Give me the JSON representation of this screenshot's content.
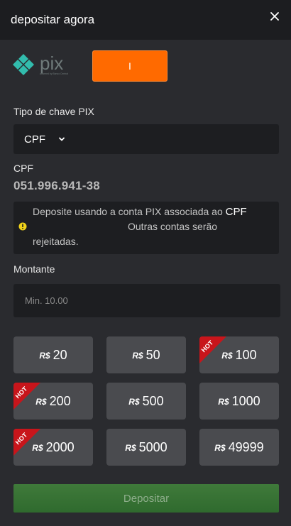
{
  "header": {
    "title": "depositar agora"
  },
  "payment": {
    "logo_text": "pix",
    "logo_subtext": "powered by Banco Central",
    "tab_label": "I"
  },
  "key_type": {
    "label": "Tipo de chave PIX",
    "selected": "CPF"
  },
  "cpf": {
    "label": "CPF",
    "value": "051.996.941-38"
  },
  "notice": {
    "text_before": "Deposite usando a conta PIX associada ao ",
    "highlight": "CPF",
    "text_after_line2": "Outras contas serão",
    "text_line3": "rejeitadas."
  },
  "amount": {
    "label": "Montante",
    "placeholder": "Min. 10.00"
  },
  "presets": {
    "currency": "R$",
    "hot_label": "HOT",
    "items": [
      {
        "value": "20",
        "hot": false
      },
      {
        "value": "50",
        "hot": false
      },
      {
        "value": "100",
        "hot": true
      },
      {
        "value": "200",
        "hot": true
      },
      {
        "value": "500",
        "hot": false
      },
      {
        "value": "1000",
        "hot": false
      },
      {
        "value": "2000",
        "hot": true
      },
      {
        "value": "5000",
        "hot": false
      },
      {
        "value": "49999",
        "hot": false
      }
    ]
  },
  "submit": {
    "label": "Depositar"
  },
  "colors": {
    "accent_orange": "#ff6a00",
    "pix_teal": "#32bcad",
    "hot_red": "#c8151b",
    "submit_green": "#3a7536",
    "warning_yellow": "#f0d21a"
  }
}
